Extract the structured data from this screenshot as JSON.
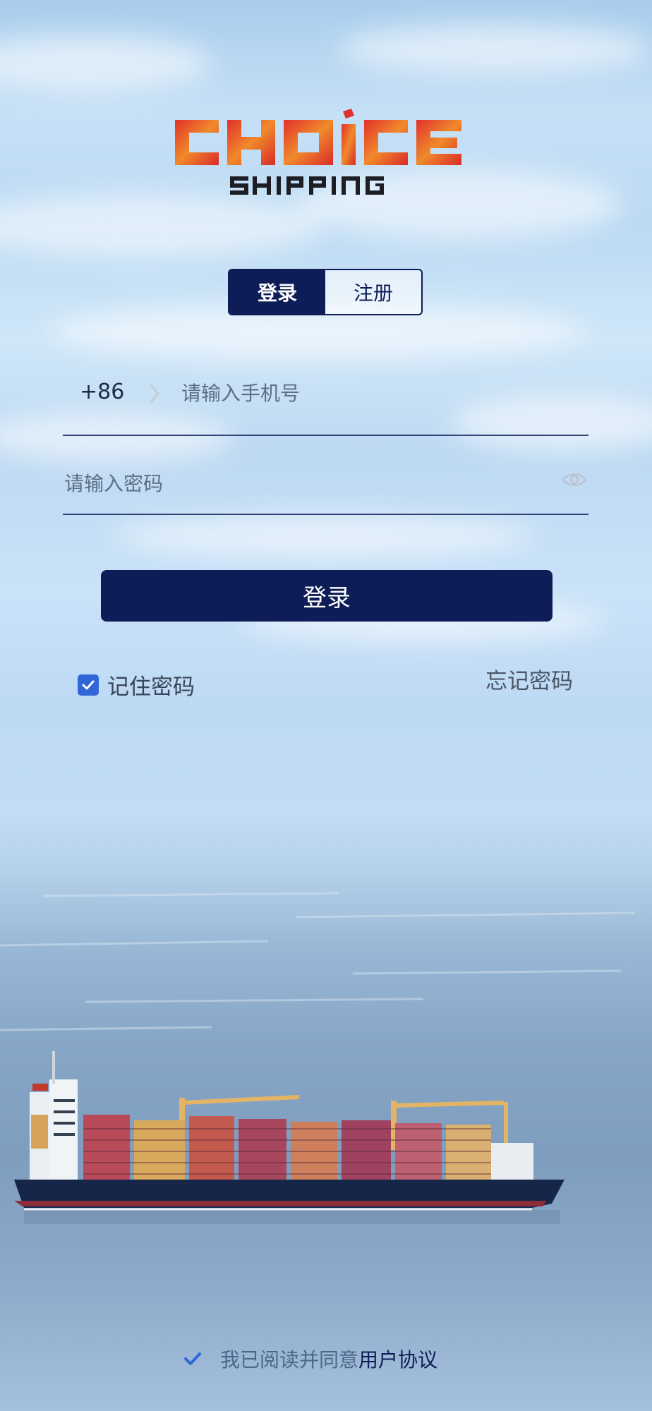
{
  "brand": {
    "name": "CHOICE",
    "subtitle": "SHIPPING",
    "colors": {
      "primary": "#0e1d57",
      "logo_red": "#e2302b",
      "logo_orange": "#f08a2b"
    }
  },
  "tabs": [
    {
      "label": "登录",
      "active": true
    },
    {
      "label": "注册",
      "active": false
    }
  ],
  "phone": {
    "country_code": "+86",
    "placeholder": "请输入手机号",
    "value": ""
  },
  "password": {
    "placeholder": "请输入密码",
    "value": ""
  },
  "login_button": "登录",
  "remember": {
    "label": "记住密码",
    "checked": true
  },
  "forgot_link": "忘记密码",
  "agreement": {
    "text": "我已阅读并同意",
    "link": "用户协议",
    "checked": true
  },
  "icons": {
    "chevron": "chevron-right-icon",
    "eye": "eye-icon",
    "check": "check-icon"
  }
}
